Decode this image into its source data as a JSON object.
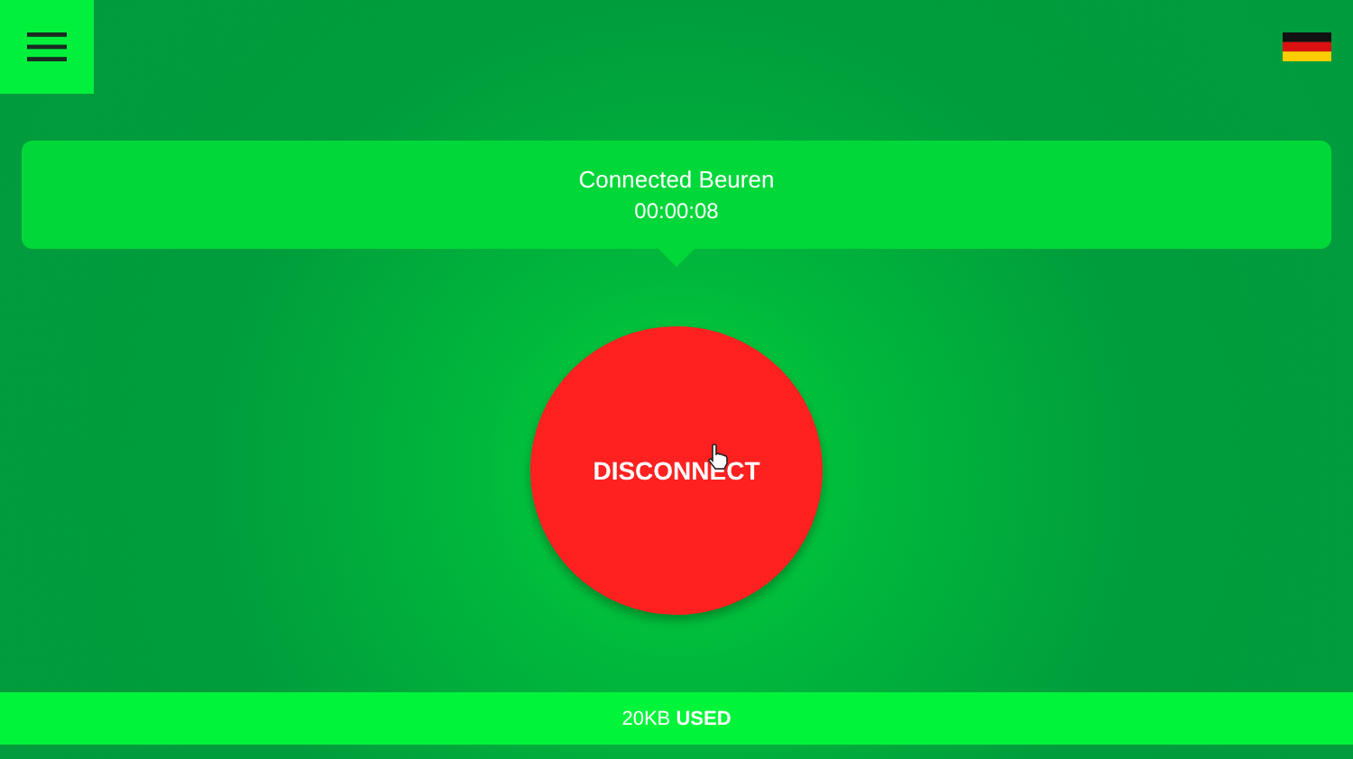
{
  "status": {
    "title": "Connected Beuren",
    "timer": "00:00:08"
  },
  "action_button": {
    "label": "DISCONNECT"
  },
  "usage": {
    "text": "20KB **USED**"
  }
}
